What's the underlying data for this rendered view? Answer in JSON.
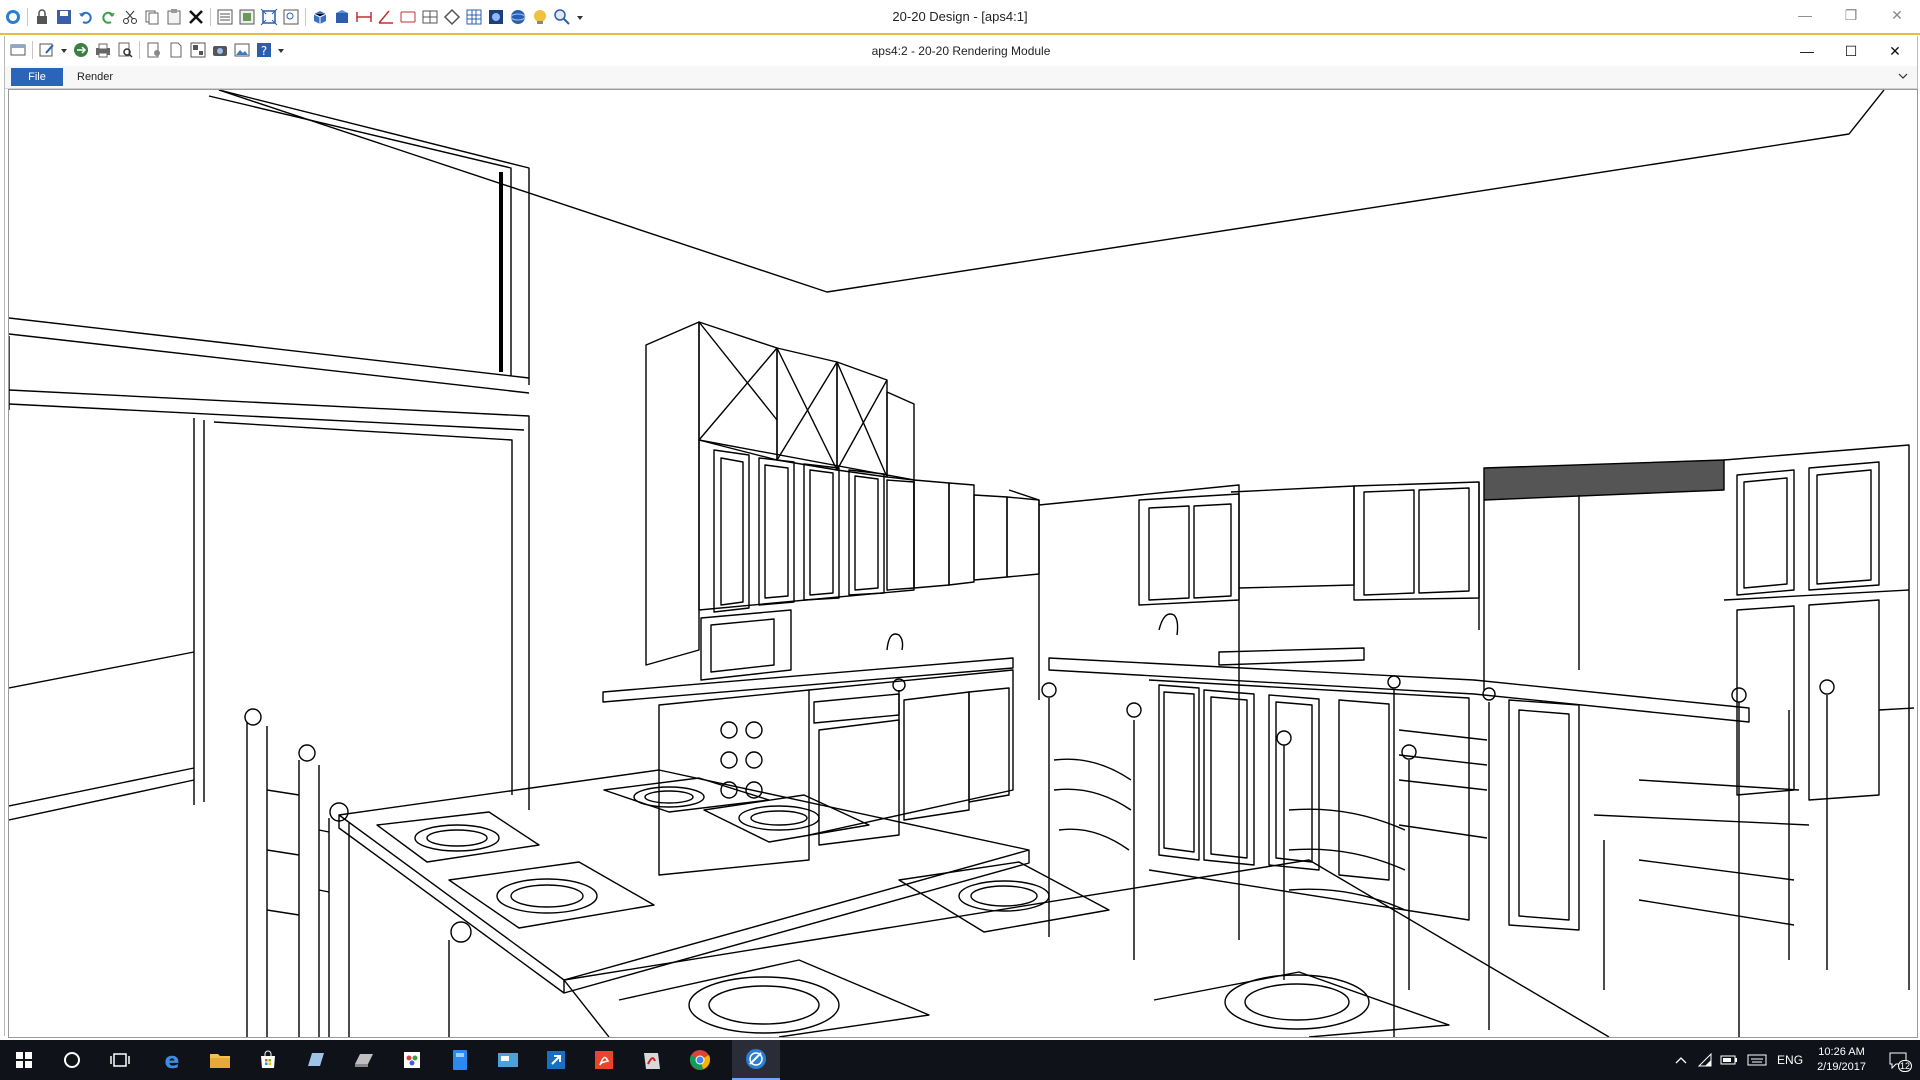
{
  "outer_window": {
    "title": "20-20 Design - [aps4:1]",
    "controls": {
      "minimize": "—",
      "restore": "❐",
      "close": "✕"
    }
  },
  "inner_window": {
    "title": "aps4:2 - 20-20 Rendering Module",
    "controls": {
      "minimize": "—",
      "maximize": "☐",
      "close": "✕"
    }
  },
  "menu": {
    "items": [
      "File",
      "Render"
    ],
    "active": "File"
  },
  "taskbar": {
    "language": "ENG",
    "time": "10:26 AM",
    "date": "2/19/2017",
    "notification_count": "12"
  },
  "colors": {
    "accent_line": "#e7b84a",
    "menu_active": "#2b64b8",
    "taskbar_bg": "#10121a"
  }
}
